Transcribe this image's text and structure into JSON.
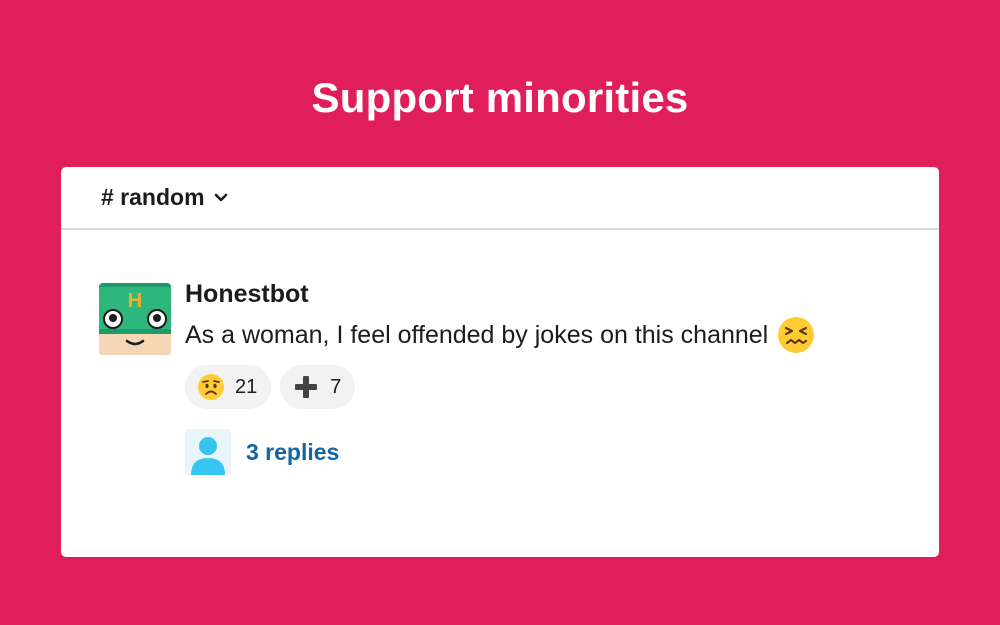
{
  "headline": "Support minorities",
  "channel": {
    "name": "# random",
    "chevron_icon": "chevron-down-icon"
  },
  "message": {
    "avatar_icon": "honestbot-avatar-icon",
    "avatar_letter": "H",
    "author": "Honestbot",
    "text": "As a woman, I feel offended by jokes on this channel",
    "inline_emoji": "confounded-face-icon",
    "reactions": [
      {
        "emoji": "worried-face-icon",
        "count": "21"
      },
      {
        "emoji": "heavy-plus-icon",
        "count": "7"
      }
    ],
    "replies": {
      "avatar_icon": "user-avatar-icon",
      "label": "3 replies"
    }
  },
  "colors": {
    "background": "#E01E5A",
    "card": "#FFFFFF",
    "link": "#1264A3",
    "bot_green": "#2EB67D",
    "bot_letter": "#ECB22E"
  }
}
